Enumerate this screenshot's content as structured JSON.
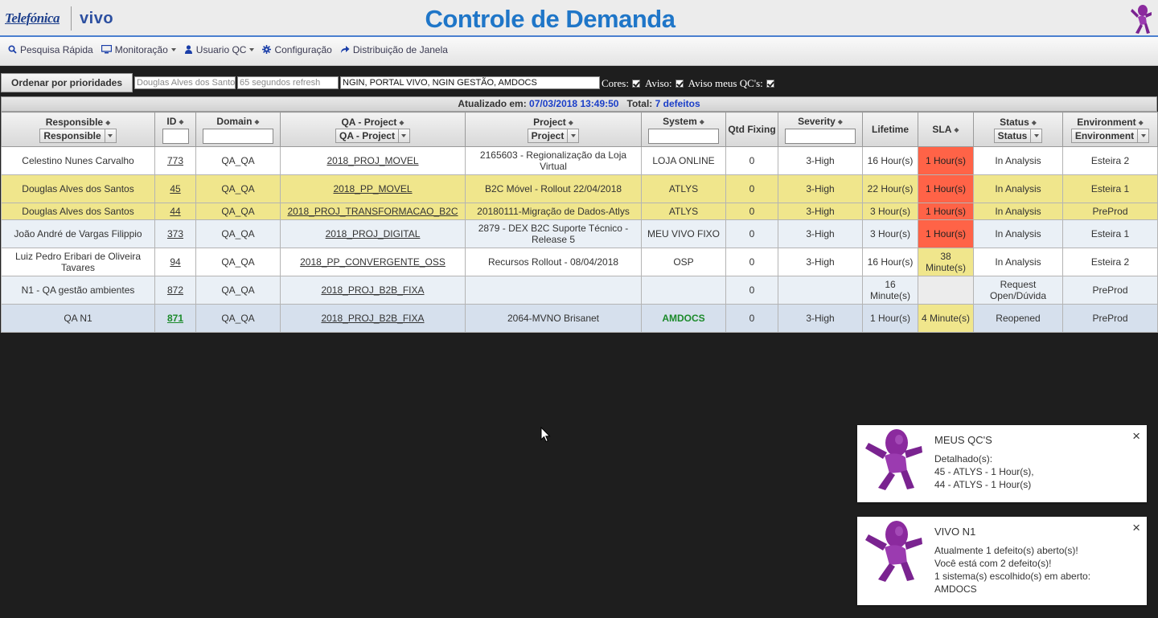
{
  "header": {
    "logo_primary": "Telefónica",
    "logo_secondary": "vivo",
    "title": "Controle de Demanda"
  },
  "menu": [
    {
      "icon": "search-icon",
      "label": "Pesquisa Rápida",
      "dropdown": false
    },
    {
      "icon": "monitor-icon",
      "label": "Monitoração",
      "dropdown": true
    },
    {
      "icon": "user-icon",
      "label": "Usuario QC",
      "dropdown": true
    },
    {
      "icon": "gear-icon",
      "label": "Configuração",
      "dropdown": false
    },
    {
      "icon": "share-icon",
      "label": "Distribuição de Janela",
      "dropdown": false
    }
  ],
  "filters": {
    "order_button": "Ordenar por prioridades",
    "user_placeholder": "Douglas Alves dos Santos",
    "refresh_placeholder": "65 segundos refresh",
    "systems_value": "NGIN, PORTAL VIVO, NGIN GESTÃO, AMDOCS",
    "cores_label": "Cores:",
    "aviso_label": "Aviso:",
    "aviso_meus_label": "Aviso meus QC's:",
    "cores_checked": true,
    "aviso_checked": true,
    "aviso_meus_checked": true
  },
  "status_line": {
    "updated_label": "Atualizado em:",
    "updated_value": "07/03/2018 13:49:50",
    "total_label": "Total:",
    "total_value": "7 defeitos"
  },
  "columns": {
    "responsible": "Responsible",
    "responsible_filter": "Responsible",
    "id": "ID",
    "domain": "Domain",
    "qa_project": "QA - Project",
    "qa_project_filter": "QA - Project",
    "project": "Project",
    "project_filter": "Project",
    "system": "System",
    "qtd_fixing": "Qtd Fixing",
    "severity": "Severity",
    "lifetime": "Lifetime",
    "sla": "SLA",
    "status": "Status",
    "status_filter": "Status",
    "environment": "Environment",
    "environment_filter": "Environment"
  },
  "rows": [
    {
      "responsible": "Celestino Nunes Carvalho",
      "id": "773",
      "domain": "QA_QA",
      "qa_project": "2018_PROJ_MOVEL",
      "project": "2165603 - Regionalização da Loja Virtual",
      "system": "LOJA ONLINE",
      "qtd_fixing": "0",
      "severity": "3-High",
      "lifetime": "16 Hour(s)",
      "sla": "1 Hour(s)",
      "sla_level": "red",
      "status": "In Analysis",
      "environment": "Esteira 2",
      "row_style": "white"
    },
    {
      "responsible": "Douglas Alves dos Santos",
      "id": "45",
      "domain": "QA_QA",
      "qa_project": "2018_PP_MOVEL",
      "project": "B2C Móvel - Rollout 22/04/2018",
      "system": "ATLYS",
      "qtd_fixing": "0",
      "severity": "3-High",
      "lifetime": "22 Hour(s)",
      "sla": "1 Hour(s)",
      "sla_level": "red",
      "status": "In Analysis",
      "environment": "Esteira 1",
      "row_style": "yellow"
    },
    {
      "responsible": "Douglas Alves dos Santos",
      "id": "44",
      "domain": "QA_QA",
      "qa_project": "2018_PROJ_TRANSFORMACAO_B2C",
      "project": "20180111-Migração de Dados-Atlys",
      "system": "ATLYS",
      "qtd_fixing": "0",
      "severity": "3-High",
      "lifetime": "3 Hour(s)",
      "sla": "1 Hour(s)",
      "sla_level": "red",
      "status": "In Analysis",
      "environment": "PreProd",
      "row_style": "yellow"
    },
    {
      "responsible": "João André de Vargas Filippio",
      "id": "373",
      "domain": "QA_QA",
      "qa_project": "2018_PROJ_DIGITAL",
      "project": "2879 - DEX B2C Suporte Técnico - Release 5",
      "system": "MEU VIVO FIXO",
      "qtd_fixing": "0",
      "severity": "3-High",
      "lifetime": "3 Hour(s)",
      "sla": "1 Hour(s)",
      "sla_level": "red",
      "status": "In Analysis",
      "environment": "Esteira 1",
      "row_style": "blue"
    },
    {
      "responsible": "Luiz Pedro Eribari de Oliveira Tavares",
      "id": "94",
      "domain": "QA_QA",
      "qa_project": "2018_PP_CONVERGENTE_OSS",
      "project": "Recursos Rollout - 08/04/2018",
      "system": "OSP",
      "qtd_fixing": "0",
      "severity": "3-High",
      "lifetime": "16 Hour(s)",
      "sla": "38 Minute(s)",
      "sla_level": "yellow",
      "status": "In Analysis",
      "environment": "Esteira 2",
      "row_style": "white"
    },
    {
      "responsible": "N1 - QA gestão ambientes",
      "id": "872",
      "domain": "QA_QA",
      "qa_project": "2018_PROJ_B2B_FIXA",
      "project": "",
      "system": "",
      "qtd_fixing": "0",
      "severity": "",
      "lifetime": "16 Minute(s)",
      "sla": "",
      "sla_level": "empty",
      "status": "Request Open/Dúvida",
      "environment": "PreProd",
      "row_style": "blue"
    },
    {
      "responsible": "QA N1",
      "id": "871",
      "domain": "QA_QA",
      "qa_project": "2018_PROJ_B2B_FIXA",
      "project": "2064-MVNO Brisanet",
      "system": "AMDOCS",
      "qtd_fixing": "0",
      "severity": "3-High",
      "lifetime": "1 Hour(s)",
      "sla": "4 Minute(s)",
      "sla_level": "yellow",
      "status": "Reopened",
      "environment": "PreProd",
      "row_style": "selected"
    }
  ],
  "notifications": [
    {
      "title": "MEUS QC'S",
      "lines": [
        "Detalhado(s):",
        "45 - ATLYS - 1 Hour(s),",
        "44 - ATLYS - 1 Hour(s)"
      ],
      "close": "×"
    },
    {
      "title": "VIVO N1",
      "lines": [
        "Atualmente 1 defeito(s) aberto(s)!",
        "Você está com 2 defeito(s)!",
        "1 sistema(s) escolhido(s) em aberto:",
        "AMDOCS"
      ],
      "close": "×"
    }
  ],
  "colors": {
    "title_blue": "#1f76c8",
    "sla_red": "#ff6347",
    "sla_yellow": "#f0e68c",
    "row_yellow": "#f0e68c",
    "link_green": "#1b8a2a",
    "mascot_purple": "#8b2a9e"
  }
}
